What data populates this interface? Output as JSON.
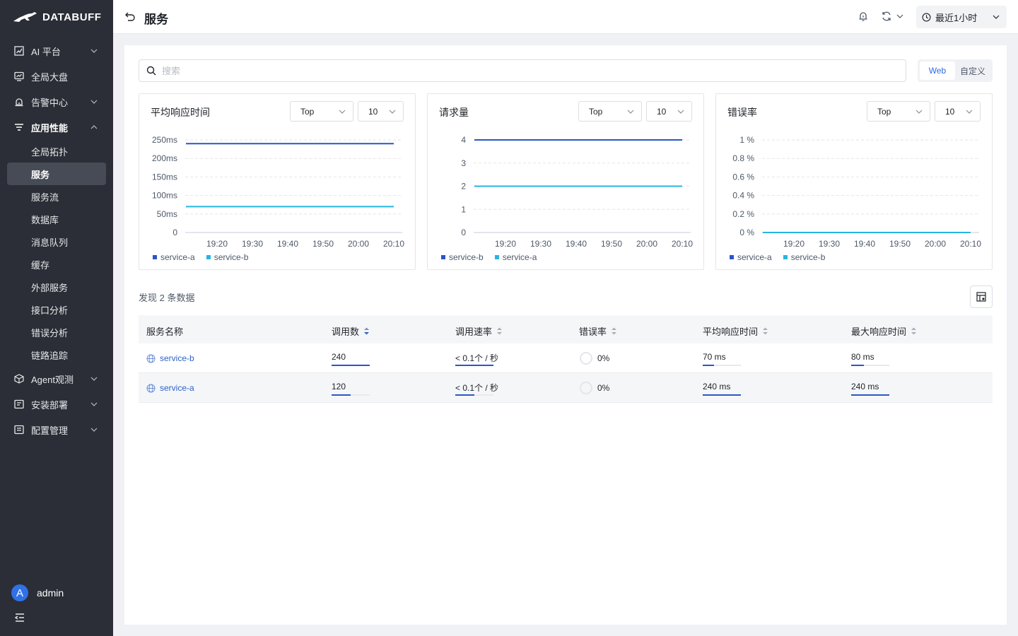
{
  "brand": {
    "name": "DATABUFF"
  },
  "nav": {
    "items": [
      {
        "label": "AI 平台",
        "icon": "chart-icon"
      },
      {
        "label": "全局大盘",
        "icon": "dashboard-icon"
      },
      {
        "label": "告警中心",
        "icon": "alarm-icon"
      },
      {
        "label": "应用性能",
        "icon": "list-icon"
      }
    ],
    "sub_items": [
      "全局拓扑",
      "服务",
      "服务流",
      "数据库",
      "消息队列",
      "缓存",
      "外部服务",
      "接口分析",
      "错误分析",
      "链路追踪"
    ],
    "bottom_items": [
      {
        "label": "Agent观测",
        "icon": "cube-icon"
      },
      {
        "label": "安装部署",
        "icon": "install-icon"
      },
      {
        "label": "配置管理",
        "icon": "config-icon"
      }
    ],
    "active_sub": "服务"
  },
  "user": {
    "initial": "A",
    "name": "admin"
  },
  "header": {
    "title": "服务",
    "time_range": "最近1小时"
  },
  "search": {
    "placeholder": "搜索",
    "value": ""
  },
  "segment": {
    "options": [
      "Web",
      "自定义"
    ],
    "selected": "Web"
  },
  "cards": [
    {
      "title": "平均响应时间",
      "sel1": "Top",
      "sel2": "10"
    },
    {
      "title": "请求量",
      "sel1": "Top",
      "sel2": "10"
    },
    {
      "title": "错误率",
      "sel1": "Top",
      "sel2": "10"
    }
  ],
  "chart_data": [
    {
      "type": "line",
      "title": "平均响应时间",
      "x": [
        "19:20",
        "19:30",
        "19:40",
        "19:50",
        "20:00",
        "20:10"
      ],
      "y_ticks": [
        "0",
        "50ms",
        "100ms",
        "150ms",
        "200ms",
        "250ms"
      ],
      "ylim": [
        0,
        250
      ],
      "series": [
        {
          "name": "service-a",
          "color": "#2c56c6",
          "value": 240
        },
        {
          "name": "service-b",
          "color": "#27b5e0",
          "value": 70
        }
      ]
    },
    {
      "type": "line",
      "title": "请求量",
      "x": [
        "19:20",
        "19:30",
        "19:40",
        "19:50",
        "20:00",
        "20:10"
      ],
      "y_ticks": [
        "0",
        "1",
        "2",
        "3",
        "4"
      ],
      "ylim": [
        0,
        4
      ],
      "series": [
        {
          "name": "service-b",
          "color": "#2c56c6",
          "value": 4
        },
        {
          "name": "service-a",
          "color": "#27b5e0",
          "value": 2
        }
      ]
    },
    {
      "type": "line",
      "title": "错误率",
      "x": [
        "19:20",
        "19:30",
        "19:40",
        "19:50",
        "20:00",
        "20:10"
      ],
      "y_ticks": [
        "0 %",
        "0.2 %",
        "0.4 %",
        "0.6 %",
        "0.8 %",
        "1 %"
      ],
      "ylim": [
        0,
        1
      ],
      "series": [
        {
          "name": "service-a",
          "color": "#2c56c6",
          "value": 0
        },
        {
          "name": "service-b",
          "color": "#27b5e0",
          "value": 0
        }
      ]
    }
  ],
  "table": {
    "summary": "发现 2 条数据",
    "columns": [
      "服务名称",
      "调用数",
      "调用速率",
      "错误率",
      "平均响应时间",
      "最大响应时间"
    ],
    "rows": [
      {
        "name": "service-b",
        "calls": "240",
        "rate": "< 0.1个 / 秒",
        "error": "0%",
        "avg": "70 ms",
        "max": "80 ms",
        "calls_frac": 1.0,
        "rate_frac": 1.0,
        "avg_frac": 0.3,
        "max_frac": 0.33
      },
      {
        "name": "service-a",
        "calls": "120",
        "rate": "< 0.1个 / 秒",
        "error": "0%",
        "avg": "240 ms",
        "max": "240 ms",
        "calls_frac": 0.5,
        "rate_frac": 0.5,
        "avg_frac": 1.0,
        "max_frac": 1.0
      }
    ]
  }
}
